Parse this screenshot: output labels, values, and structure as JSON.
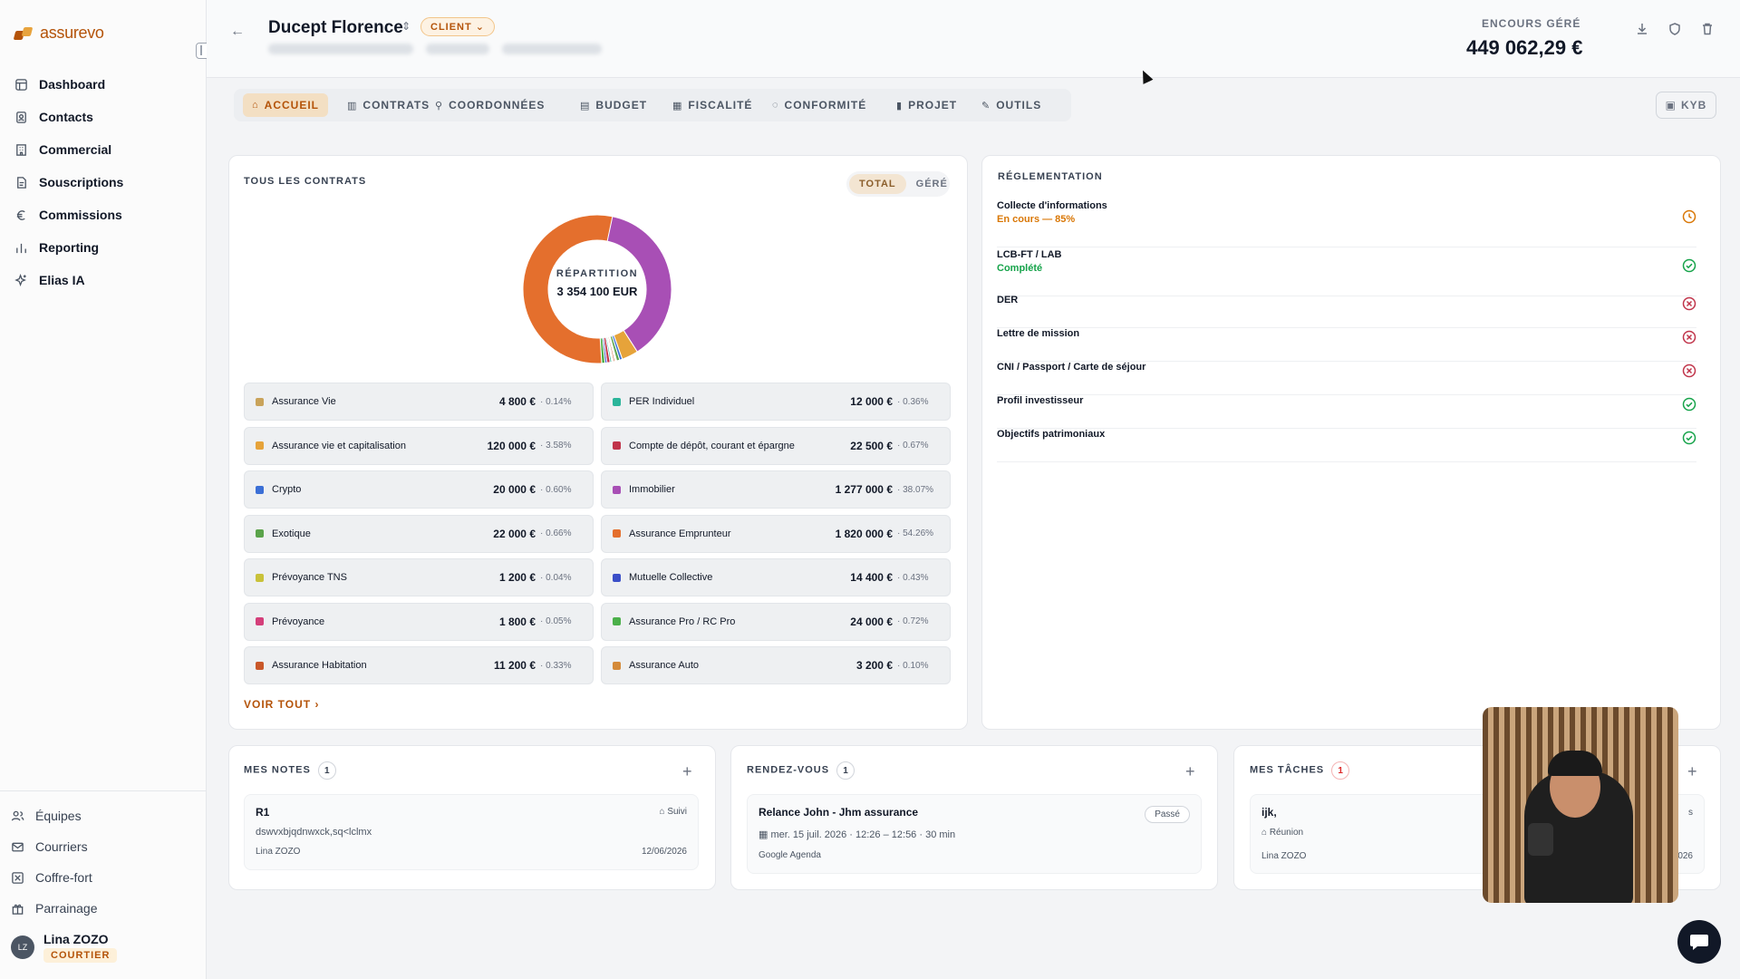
{
  "app": {
    "name": "assurevo"
  },
  "sidebar": {
    "items": [
      {
        "label": "Dashboard",
        "icon": "dashboard-icon"
      },
      {
        "label": "Contacts",
        "icon": "contacts-icon"
      },
      {
        "label": "Commercial",
        "icon": "building-icon"
      },
      {
        "label": "Souscriptions",
        "icon": "document-icon"
      },
      {
        "label": "Commissions",
        "icon": "euro-icon"
      },
      {
        "label": "Reporting",
        "icon": "bar-chart-icon"
      },
      {
        "label": "Elias IA",
        "icon": "sparkle-icon"
      }
    ],
    "bottom_items": [
      {
        "label": "Équipes",
        "icon": "users-icon"
      },
      {
        "label": "Courriers",
        "icon": "mail-icon"
      },
      {
        "label": "Coffre-fort",
        "icon": "vault-icon"
      },
      {
        "label": "Parrainage",
        "icon": "gift-icon"
      }
    ],
    "user": {
      "initials": "LZ",
      "name": "Lina ZOZO",
      "role": "COURTIER"
    }
  },
  "header": {
    "client_name": "Ducept Florence",
    "client_badge": "CLIENT",
    "encours_label": "ENCOURS GÉRÉ",
    "encours_value": "449 062,29 €"
  },
  "tabs": [
    {
      "label": "ACCUEIL",
      "active": true
    },
    {
      "label": "CONTRATS"
    },
    {
      "label": "COORDONNÉES"
    },
    {
      "label": "BUDGET"
    },
    {
      "label": "FISCALITÉ"
    },
    {
      "label": "CONFORMITÉ"
    },
    {
      "label": "PROJET"
    },
    {
      "label": "OUTILS"
    }
  ],
  "kyb_label": "KYB",
  "contracts": {
    "title": "TOUS LES CONTRATS",
    "toggle": {
      "total": "TOTAL",
      "gere": "GÉRÉ"
    },
    "donut_label": "RÉPARTITION",
    "donut_total": "3 354 100 EUR",
    "voir_tout": "VOIR TOUT",
    "items": [
      {
        "name": "Assurance Vie",
        "value": "4 800 €",
        "pct": "· 0.14%",
        "share": 0.14,
        "color": "#c9a35a"
      },
      {
        "name": "PER Individuel",
        "value": "12 000 €",
        "pct": "· 0.36%",
        "share": 0.36,
        "color": "#2bb59a"
      },
      {
        "name": "Assurance vie et capitalisation",
        "value": "120 000 €",
        "pct": "· 3.58%",
        "share": 3.58,
        "color": "#e6a33a"
      },
      {
        "name": "Compte de dépôt, courant et épargne",
        "value": "22 500 €",
        "pct": "· 0.67%",
        "share": 0.67,
        "color": "#c0344a"
      },
      {
        "name": "Crypto",
        "value": "20 000 €",
        "pct": "· 0.60%",
        "share": 0.6,
        "color": "#3b6fd6"
      },
      {
        "name": "Immobilier",
        "value": "1 277 000 €",
        "pct": "· 38.07%",
        "share": 38.07,
        "color": "#a84fb5"
      },
      {
        "name": "Exotique",
        "value": "22 000 €",
        "pct": "· 0.66%",
        "share": 0.66,
        "color": "#5aa34a"
      },
      {
        "name": "Assurance Emprunteur",
        "value": "1 820 000 €",
        "pct": "· 54.26%",
        "share": 54.26,
        "color": "#e46f2d"
      },
      {
        "name": "Prévoyance TNS",
        "value": "1 200 €",
        "pct": "· 0.04%",
        "share": 0.04,
        "color": "#c9c23a"
      },
      {
        "name": "Mutuelle Collective",
        "value": "14 400 €",
        "pct": "· 0.43%",
        "share": 0.43,
        "color": "#3b4fc8"
      },
      {
        "name": "Prévoyance",
        "value": "1 800 €",
        "pct": "· 0.05%",
        "share": 0.05,
        "color": "#d43f7a"
      },
      {
        "name": "Assurance Pro / RC Pro",
        "value": "24 000 €",
        "pct": "· 0.72%",
        "share": 0.72,
        "color": "#4bb04a"
      },
      {
        "name": "Assurance Habitation",
        "value": "11 200 €",
        "pct": "· 0.33%",
        "share": 0.33,
        "color": "#c9582a"
      },
      {
        "name": "Assurance Auto",
        "value": "3 200 €",
        "pct": "· 0.10%",
        "share": 0.1,
        "color": "#d48a3a"
      }
    ]
  },
  "reglementation": {
    "title": "RÉGLEMENTATION",
    "items": [
      {
        "name": "Collecte d'informations",
        "status": "En cours — 85%",
        "state": "pending",
        "status_color": "#d97706"
      },
      {
        "name": "LCB-FT / LAB",
        "status": "Complété",
        "state": "ok",
        "status_color": "#16a34a"
      },
      {
        "name": "DER",
        "status": "",
        "state": "missing"
      },
      {
        "name": "Lettre de mission",
        "status": "",
        "state": "missing"
      },
      {
        "name": "CNI / Passport / Carte de séjour",
        "status": "",
        "state": "missing"
      },
      {
        "name": "Profil investisseur",
        "status": "",
        "state": "ok"
      },
      {
        "name": "Objectifs patrimoniaux",
        "status": "",
        "state": "ok"
      }
    ]
  },
  "notes": {
    "title": "MES NOTES",
    "count": "1",
    "item": {
      "title": "R1",
      "tag": "Suivi",
      "body": "dswvxbjqdnwxck,sq<lclmx",
      "author": "Lina ZOZO",
      "date": "12/06/2026"
    }
  },
  "rdv": {
    "title": "RENDEZ-VOUS",
    "count": "1",
    "item": {
      "title": "Relance John - Jhm assurance",
      "status": "Passé",
      "when": "mer. 15 juil. 2026 · 12:26 – 12:56 · 30 min",
      "source": "Google Agenda"
    }
  },
  "taches": {
    "title": "MES TÂCHES",
    "count": "1",
    "item": {
      "title": "ijk,",
      "tag": "Réunion",
      "author": "Lina ZOZO",
      "date_partial": "026",
      "status_partial": "s"
    }
  }
}
